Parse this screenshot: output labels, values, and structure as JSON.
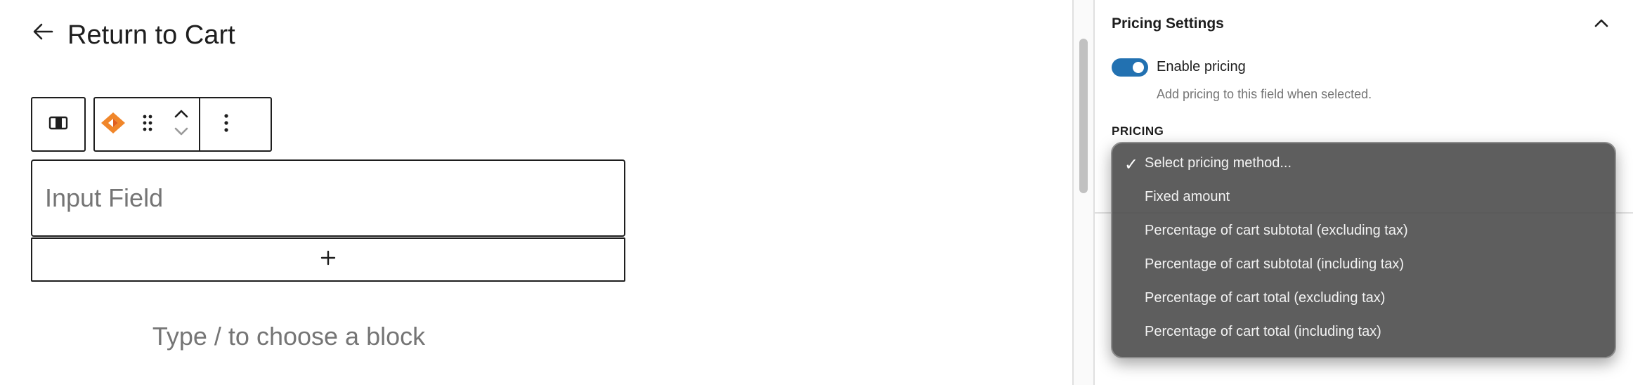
{
  "editor": {
    "back_link": "Return to Cart",
    "input_field_label": "Input Field",
    "add_block_symbol": "+",
    "placeholder": "Type / to choose a block"
  },
  "toolbar": {
    "icons": [
      "select-parent-icon",
      "plugin-logo-icon",
      "drag-handle-icon",
      "move-up-icon",
      "move-down-icon",
      "more-options-icon"
    ]
  },
  "sidebar": {
    "panel_title": "Pricing Settings",
    "toggle": {
      "label": "Enable pricing",
      "help": "Add pricing to this field when selected.",
      "enabled": true
    },
    "pricing_label": "PRICING",
    "dropdown": {
      "selected_index": 0,
      "options": [
        "Select pricing method...",
        "Fixed amount",
        "Percentage of cart subtotal (excluding tax)",
        "Percentage of cart subtotal (including tax)",
        "Percentage of cart total (excluding tax)",
        "Percentage of cart total (including tax)"
      ]
    }
  },
  "colors": {
    "accent": "#2271b1",
    "logo": "#f0862a",
    "text": "#1e1e1e",
    "muted": "#757575",
    "dropdown_bg": "#484848"
  }
}
